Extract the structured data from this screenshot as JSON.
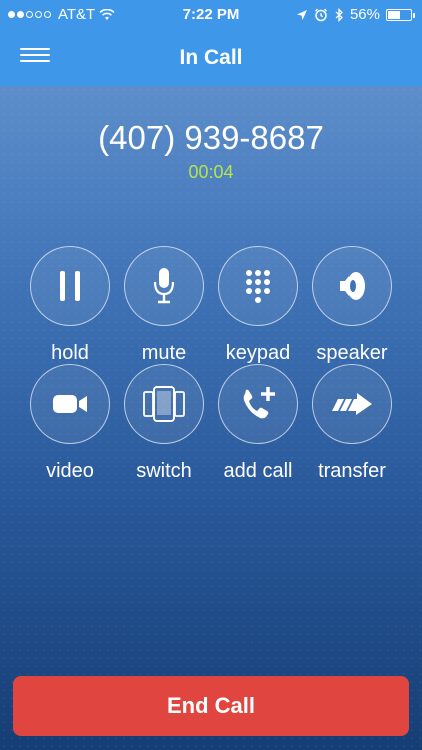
{
  "status_bar": {
    "carrier": "AT&T",
    "time": "7:22 PM",
    "battery_percent": "56%",
    "signal_bars_filled": 2,
    "signal_bars_total": 5,
    "battery_level": 0.56
  },
  "nav": {
    "title": "In Call",
    "menu_icon": "hamburger-menu-icon"
  },
  "call": {
    "number": "(407) 939-8687",
    "duration": "00:04",
    "duration_color": "#b5e34d"
  },
  "controls": [
    {
      "id": "hold",
      "label": "hold",
      "icon": "pause-icon"
    },
    {
      "id": "mute",
      "label": "mute",
      "icon": "microphone-icon"
    },
    {
      "id": "keypad",
      "label": "keypad",
      "icon": "keypad-icon"
    },
    {
      "id": "speaker",
      "label": "speaker",
      "icon": "speaker-icon"
    },
    {
      "id": "video",
      "label": "video",
      "icon": "video-camera-icon"
    },
    {
      "id": "switch",
      "label": "switch",
      "icon": "switch-devices-icon"
    },
    {
      "id": "add-call",
      "label": "add call",
      "icon": "add-call-icon"
    },
    {
      "id": "transfer",
      "label": "transfer",
      "icon": "transfer-arrow-icon"
    }
  ],
  "end_call": {
    "label": "End Call",
    "color": "#e0463f"
  },
  "colors": {
    "header": "#3f97ea",
    "background_bottom": "#163e75"
  }
}
